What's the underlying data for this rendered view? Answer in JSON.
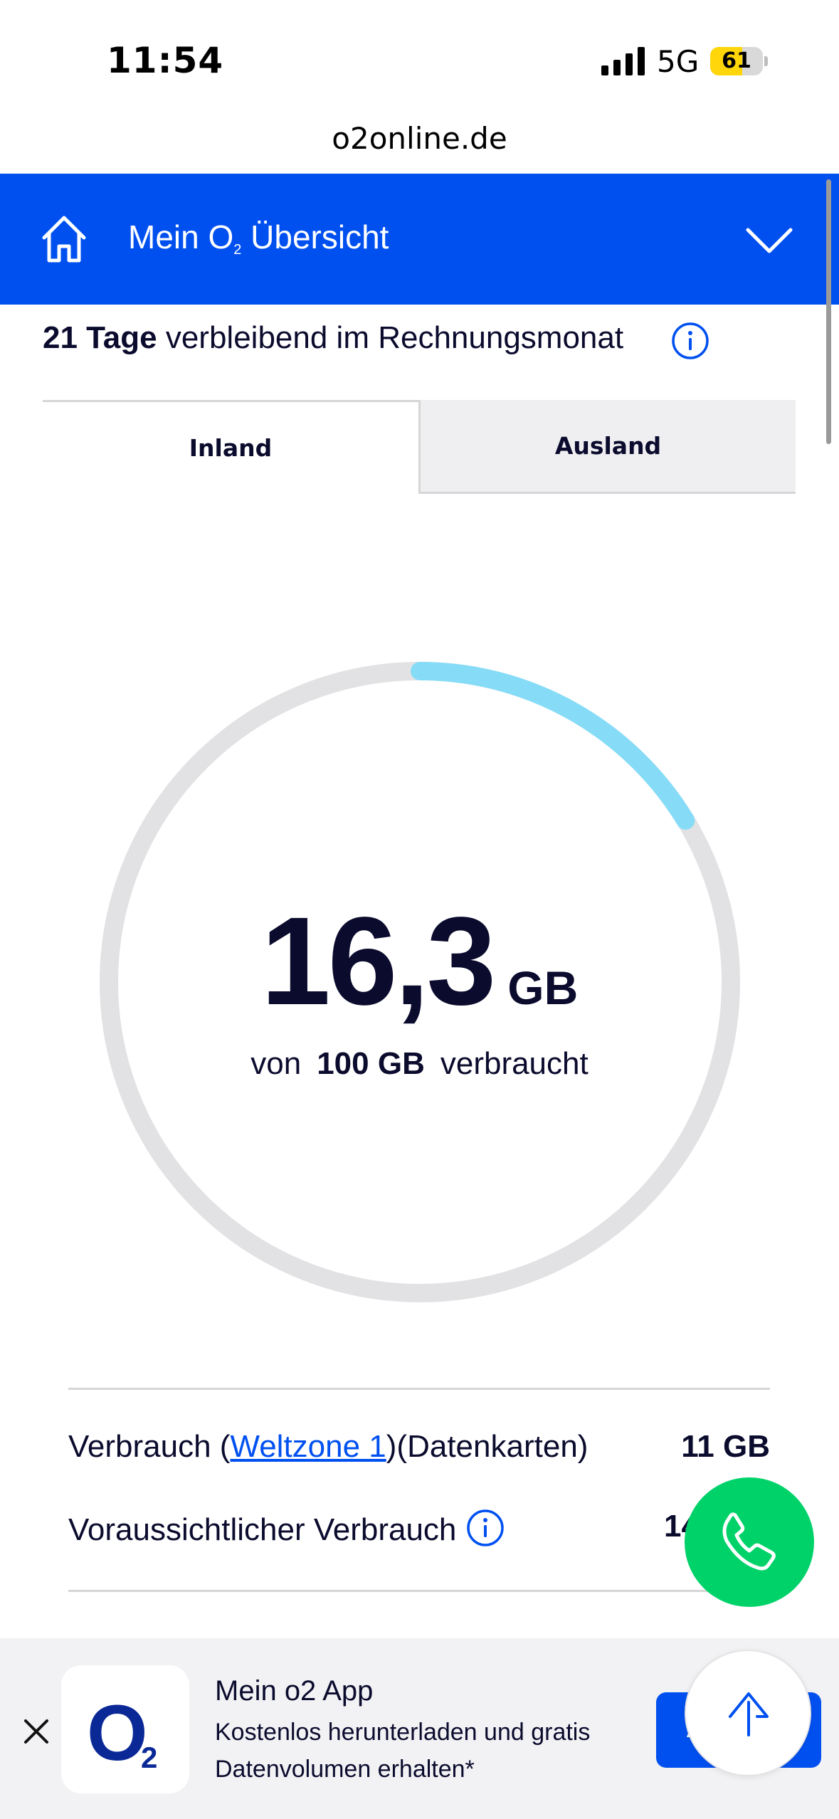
{
  "status_bar": {
    "time": "11:54",
    "network": "5G",
    "battery": "61",
    "battery_level": 0.61
  },
  "browser": {
    "url": "o2online.de"
  },
  "header": {
    "title": "Mein O",
    "title_sub": "2",
    "title_rest": " Übersicht",
    "accent": "#0050f0"
  },
  "billing": {
    "days_bold": "21 Tage",
    "days_text": " verbleibend im Rechnungsmonat"
  },
  "tabs": [
    {
      "label": "Inland",
      "active": true
    },
    {
      "label": "Ausland",
      "active": false
    }
  ],
  "usage": {
    "used": "16,3",
    "unit": "GB",
    "sub_prefix": "von",
    "total": "100 GB",
    "sub_suffix": "verbraucht",
    "used_fraction": 0.163,
    "arc_color": "#86dcf7",
    "track_color": "#e2e2e4"
  },
  "rows": [
    {
      "label_prefix": "Verbrauch (",
      "link": "Weltzone 1",
      "label_suffix": ")(Datenkarten)",
      "value": "11 GB"
    },
    {
      "label": "Voraussichtlicher Verbrauch",
      "value": "14"
    }
  ],
  "app_banner": {
    "logo_main": "O",
    "logo_sub": "2",
    "title": "Mein o2 App",
    "description": "Kostenlos herunterladen und gratis Datenvolumen erhalten*",
    "cta": "A"
  }
}
